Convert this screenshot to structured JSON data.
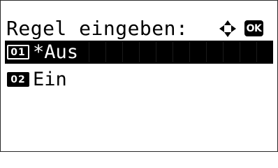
{
  "screen": {
    "title": "Regel eingeben:",
    "nav_icon": "four-way-arrow-icon",
    "ok_label": "OK"
  },
  "options": [
    {
      "number": "01",
      "label": "*Aus",
      "selected": true
    },
    {
      "number": "02",
      "label": "Ein",
      "selected": false
    }
  ],
  "colors": {
    "background": "#ffffff",
    "foreground": "#000000",
    "highlight": "#000000"
  }
}
